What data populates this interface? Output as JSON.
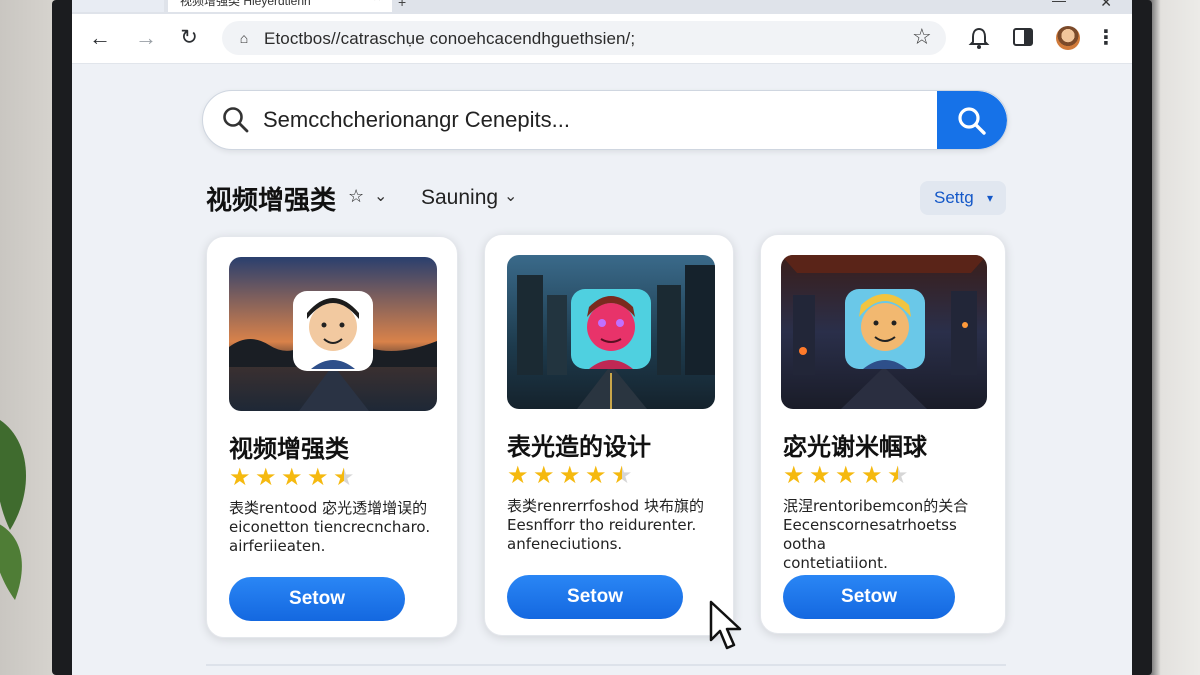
{
  "browser": {
    "tabs": [
      {
        "label": ""
      },
      {
        "label": "视频增强类 Hleyerdtienh"
      }
    ],
    "address": "Etoctbos//catraschụe conoehcacendhguethsien/;"
  },
  "search": {
    "placeholder": "Semcchcherionangr Cenepits..."
  },
  "filters": {
    "category": "视频增强类",
    "category_icon": "star-outline-icon",
    "sort": "Sauning",
    "settings": "Settg"
  },
  "cards": [
    {
      "title": "视频增强类",
      "rating": 4.5,
      "desc_line1": "表类rentood 宓光透增增误的",
      "desc_line2": "eiconetton tiencrecncharo.",
      "desc_line3": "airferiieaten.",
      "button": "Setow",
      "thumb": "sunset-road-avatar"
    },
    {
      "title": "表光造的设计",
      "rating": 4.5,
      "desc_line1": "表类renrerrfoshod 块布旗的",
      "desc_line2": "Eesnfforr tho reidurenter.",
      "desc_line3": "anfeneciutions.",
      "button": "Setow",
      "thumb": "neon-city-avatar"
    },
    {
      "title": "宓光谢米帼球",
      "rating": 4.5,
      "desc_line1": "泯涅rentoribemcon的关合",
      "desc_line2": "Eecenscornesatrhoetss ootha",
      "desc_line3": "contetiatiiont.",
      "button": "Setow",
      "thumb": "tunnel-city-avatar"
    }
  ],
  "colors": {
    "accent": "#1672e8",
    "star": "#f5b90f",
    "star_empty": "#d6d6d6"
  }
}
